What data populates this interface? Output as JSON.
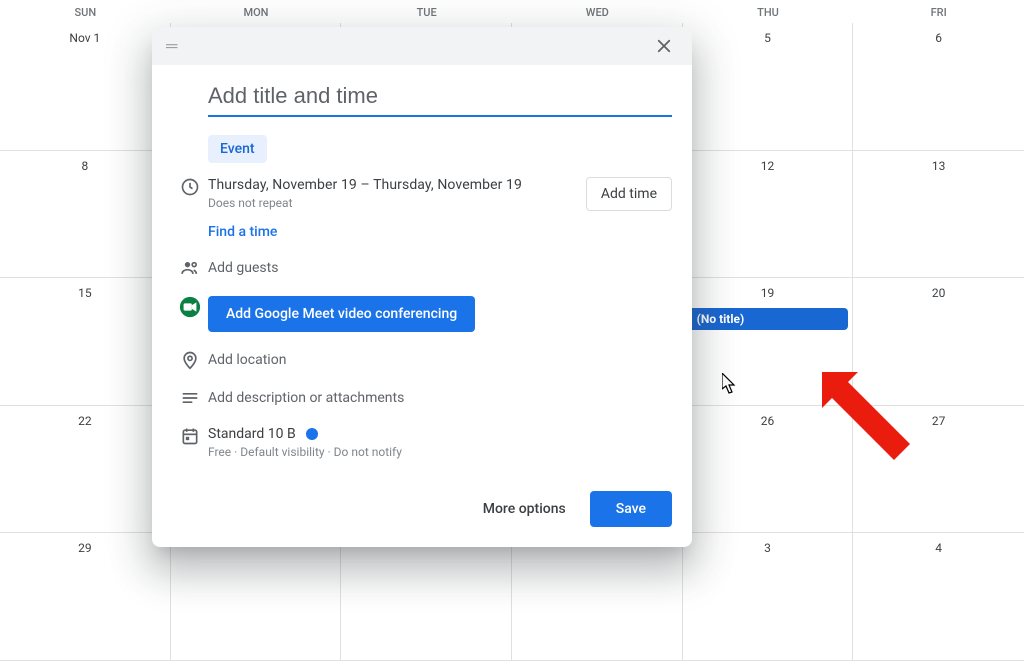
{
  "calendar": {
    "day_headers": [
      "SUN",
      "MON",
      "TUE",
      "WED",
      "THU",
      "FRI"
    ],
    "rows": [
      [
        "Nov 1",
        "",
        "",
        "",
        "5",
        "6"
      ],
      [
        "8",
        "",
        "",
        "",
        "12",
        "13"
      ],
      [
        "15",
        "",
        "",
        "",
        "19",
        "20"
      ],
      [
        "22",
        "",
        "",
        "",
        "26",
        "27"
      ],
      [
        "29",
        "",
        "",
        "",
        "3",
        "4"
      ]
    ],
    "event_chip_label": "(No title)"
  },
  "modal": {
    "title_placeholder": "Add title and time",
    "tab_event": "Event",
    "date_start": "Thursday, November 19",
    "date_sep": " – ",
    "date_end": "Thursday, November 19",
    "repeat": "Does not repeat",
    "add_time": "Add time",
    "find_time": "Find a time",
    "add_guests": "Add guests",
    "meet_button": "Add Google Meet video conferencing",
    "add_location": "Add location",
    "add_description": "Add description or attachments",
    "calendar_name": "Standard 10 B",
    "calendar_meta": "Free · Default visibility · Do not notify",
    "more_options": "More options",
    "save": "Save"
  }
}
